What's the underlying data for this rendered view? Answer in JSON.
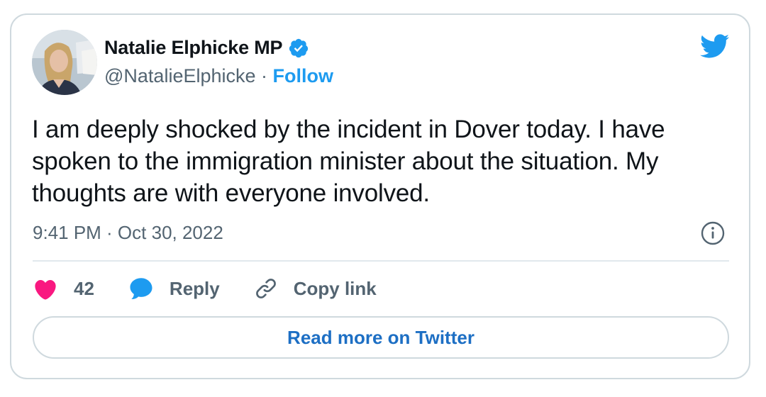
{
  "tweet": {
    "author_name": "Natalie Elphicke MP",
    "handle": "@NatalieElphicke",
    "separator": "·",
    "follow_label": "Follow",
    "text": "I am deeply shocked by the incident in Dover today. I have spoken to the immigration minister about the situation. My thoughts are with everyone involved.",
    "timestamp": "9:41 PM · Oct 30, 2022"
  },
  "actions": {
    "like_count": "42",
    "reply_label": "Reply",
    "copy_label": "Copy link"
  },
  "footer": {
    "read_more_label": "Read more on Twitter"
  },
  "icons": {
    "verified": "verified-badge-icon",
    "brand": "twitter-bird-icon",
    "info": "info-icon",
    "like": "heart-icon",
    "reply": "speech-bubble-icon",
    "copy": "link-icon"
  },
  "colors": {
    "accent": "#1d9bf0",
    "like": "#f91880",
    "muted": "#536471",
    "read_more": "#1d6fc4"
  }
}
